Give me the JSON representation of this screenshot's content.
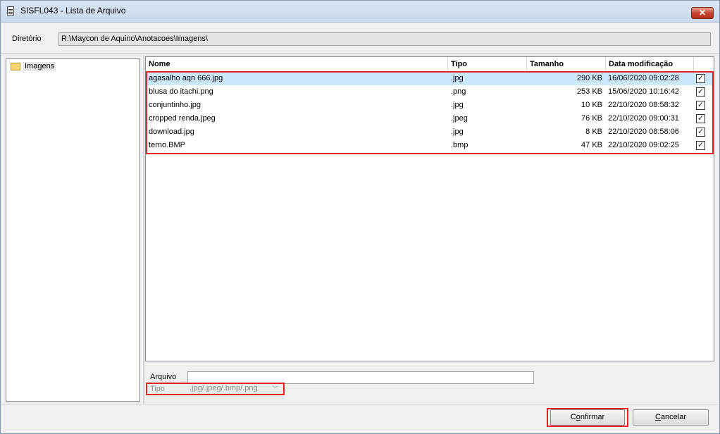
{
  "window": {
    "title": "SISFL043 - Lista de Arquivo",
    "close_label": "✕"
  },
  "directory": {
    "label": "Diretório",
    "path": "R:\\Maycon de Aquino\\Anotacoes\\Imagens\\"
  },
  "tree": {
    "items": [
      {
        "label": "Imagens"
      }
    ]
  },
  "file_list": {
    "columns": [
      "Nome",
      "Tipo",
      "Tamanho",
      "Data modificação"
    ],
    "rows": [
      {
        "name": "agasalho aqn 666.jpg",
        "type": ".jpg",
        "size": "290 KB",
        "date": "16/06/2020 09:02:28",
        "checked": true,
        "selected": true
      },
      {
        "name": "blusa do itachi.png",
        "type": ".png",
        "size": "253 KB",
        "date": "15/06/2020 10:16:42",
        "checked": true,
        "selected": false
      },
      {
        "name": "conjuntinho.jpg",
        "type": ".jpg",
        "size": "10 KB",
        "date": "22/10/2020 08:58:32",
        "checked": true,
        "selected": false
      },
      {
        "name": "cropped renda.jpeg",
        "type": ".jpeg",
        "size": "76 KB",
        "date": "22/10/2020 09:00:31",
        "checked": true,
        "selected": false
      },
      {
        "name": "download.jpg",
        "type": ".jpg",
        "size": "8 KB",
        "date": "22/10/2020 08:58:06",
        "checked": true,
        "selected": false
      },
      {
        "name": "terno.BMP",
        "type": ".bmp",
        "size": "47 KB",
        "date": "22/10/2020 09:02:25",
        "checked": true,
        "selected": false
      }
    ]
  },
  "file_field": {
    "label": "Arquivo",
    "value": ""
  },
  "type_field": {
    "label": "Tipo",
    "value": ".jpg/.jpeg/.bmp/.png"
  },
  "buttons": {
    "confirm": {
      "pre": "C",
      "accel": "o",
      "post": "nfirmar"
    },
    "cancel": {
      "pre": "",
      "accel": "C",
      "post": "ancelar"
    }
  },
  "colors": {
    "highlight": "#e0262b",
    "selection": "#cce8ff"
  }
}
